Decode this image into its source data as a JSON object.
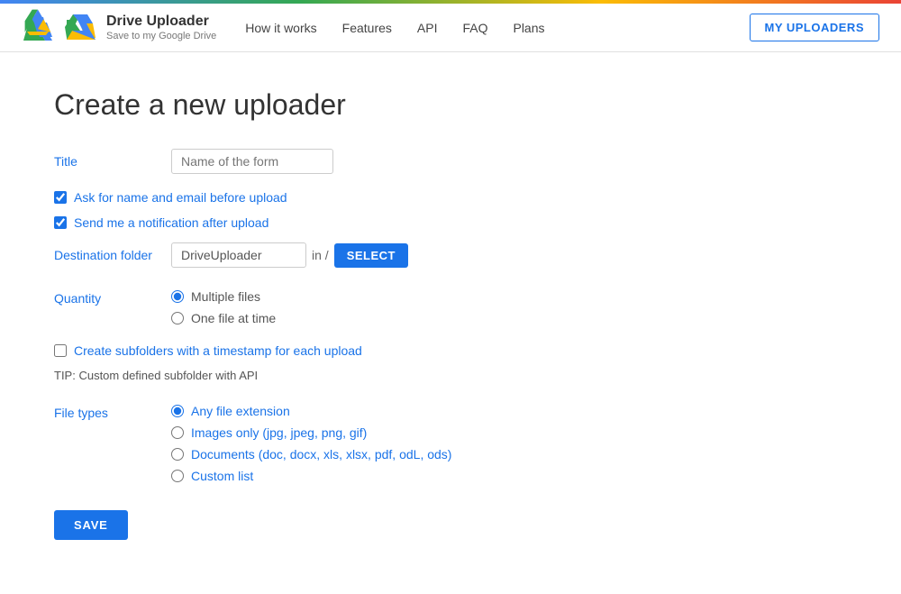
{
  "topBar": {
    "colors": [
      "#4285f4",
      "#34a853",
      "#fbbc05",
      "#ea4335"
    ]
  },
  "header": {
    "logoTitle": "Drive Uploader",
    "logoSubtitle": "Save to my Google Drive",
    "nav": {
      "items": [
        {
          "id": "how-it-works",
          "label": "How it works"
        },
        {
          "id": "features",
          "label": "Features"
        },
        {
          "id": "api",
          "label": "API"
        },
        {
          "id": "faq",
          "label": "FAQ"
        },
        {
          "id": "plans",
          "label": "Plans"
        }
      ]
    },
    "myUploadersButton": "MY UPLOADERS"
  },
  "page": {
    "title": "Create a new uploader",
    "form": {
      "titleLabel": "Title",
      "titlePlaceholder": "Name of the form",
      "checkbox1Label": "Ask for name and email before upload",
      "checkbox1Checked": true,
      "checkbox2Label": "Send me a notification after upload",
      "checkbox2Checked": true,
      "destinationLabel": "Destination folder",
      "destinationValue": "DriveUploader",
      "inSlash": "in  /",
      "selectButton": "SELECT",
      "quantityLabel": "Quantity",
      "quantityOptions": [
        {
          "id": "multiple",
          "label": "Multiple files",
          "checked": true
        },
        {
          "id": "one-file",
          "label": "One file at time",
          "checked": false
        }
      ],
      "subfoldersLabel": "Create subfolders with a timestamp for each upload",
      "subfoldersChecked": false,
      "tipText": "TIP: Custom defined subfolder with API",
      "fileTypesLabel": "File types",
      "fileTypeOptions": [
        {
          "id": "any",
          "label": "Any file extension",
          "checked": true
        },
        {
          "id": "images",
          "label": "Images only (jpg, jpeg, png, gif)",
          "checked": false
        },
        {
          "id": "documents",
          "label": "Documents (doc, docx, xls, xlsx, pdf, odL, ods)",
          "checked": false
        },
        {
          "id": "custom",
          "label": "Custom list",
          "checked": false
        }
      ],
      "saveButton": "SAVE"
    }
  }
}
